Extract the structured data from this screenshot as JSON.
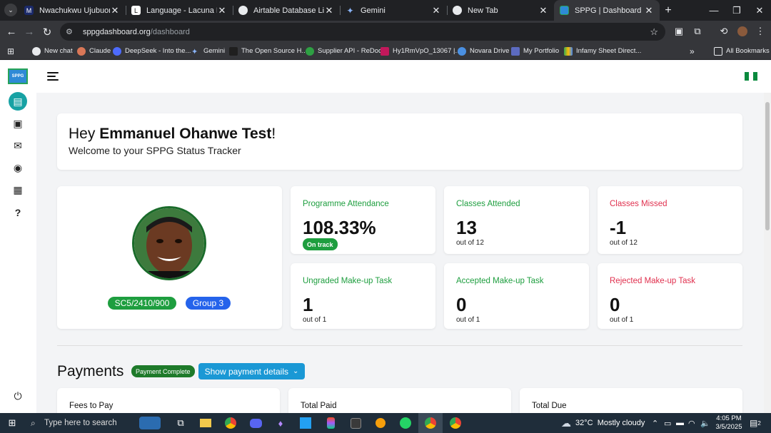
{
  "browser": {
    "tabs": [
      {
        "title": "Nwachukwu Ujubuonu",
        "icon": "mail-icon",
        "active": false
      },
      {
        "title": "Language - Lacuna Fund",
        "icon": "site-icon",
        "active": false
      },
      {
        "title": "Airtable Database Limitati",
        "icon": "chrome-icon",
        "active": false
      },
      {
        "title": "Gemini",
        "icon": "gemini-icon",
        "active": false
      },
      {
        "title": "New Tab",
        "icon": "chrome-icon",
        "active": false
      },
      {
        "title": "SPPG | Dashboard",
        "icon": "sppg-icon",
        "active": true
      }
    ],
    "url_host": "sppgdashboard.org",
    "url_path": "/dashboard",
    "bookmarks": [
      "New chat",
      "Claude",
      "DeepSeek - Into the...",
      "Gemini",
      "The Open Source H...",
      "Supplier API - ReDoc",
      "Hy1RmVpO_13067 |...",
      "Novara Drive",
      "My Portfolio",
      "Infamy Sheet Direct..."
    ],
    "all_bookmarks": "All Bookmarks"
  },
  "dashboard": {
    "greeting_prefix": "Hey ",
    "user_name": "Emmanuel Ohanwe Test",
    "greeting_suffix": "!",
    "welcome": "Welcome to your SPPG Status Tracker",
    "profile": {
      "id_tag": "SC5/2410/900",
      "group_tag": "Group 3"
    },
    "stats": [
      {
        "label": "Programme Attendance",
        "value": "108.33%",
        "badge": "On track",
        "color": "#1e9e3f"
      },
      {
        "label": "Classes Attended",
        "value": "13",
        "sub": "out of 12",
        "color": "#1e9e3f"
      },
      {
        "label": "Classes Missed",
        "value": "-1",
        "sub": "out of 12",
        "color": "#e0304e"
      },
      {
        "label": "Ungraded Make-up Task",
        "value": "1",
        "sub": "out of 1",
        "color": "#1e9e3f"
      },
      {
        "label": "Accepted Make-up Task",
        "value": "0",
        "sub": "out of 1",
        "color": "#1e9e3f"
      },
      {
        "label": "Rejected Make-up Task",
        "value": "0",
        "sub": "out of 1",
        "color": "#e0304e"
      }
    ],
    "payments": {
      "heading": "Payments",
      "status_badge": "Payment Complete",
      "details_button": "Show payment details",
      "cards": [
        "Fees to Pay",
        "Total Paid",
        "Total Due"
      ]
    }
  },
  "taskbar": {
    "search_placeholder": "Type here to search",
    "weather": "32°C  Mostly cloudy",
    "time": "4:05 PM",
    "date": "3/5/2025",
    "notifications": "2"
  }
}
